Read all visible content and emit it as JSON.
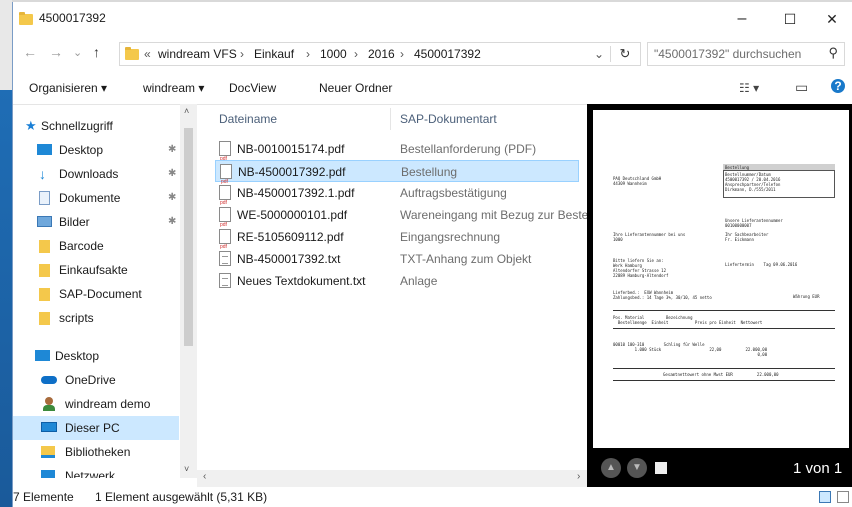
{
  "window": {
    "title": "4500017392",
    "min": "–",
    "max": "☐",
    "close": "✕"
  },
  "address": {
    "back": "←",
    "forward": "→",
    "dropdown": "⌄",
    "up": "↑",
    "chevron": "«",
    "crumbs": [
      "windream VFS",
      "Einkauf",
      "1000",
      "2016",
      "4500017392"
    ],
    "sep": "›",
    "refresh": "↻",
    "search_placeholder": "\"4500017392\" durchsuchen",
    "search_icon": "⚲"
  },
  "toolbar": {
    "organize": "Organisieren ▾",
    "windream": "windream ▾",
    "docview": "DocView",
    "new_folder": "Neuer Ordner",
    "view_icon": "☷ ▾",
    "pane_icon": "▭",
    "help_icon": "?"
  },
  "navigation": {
    "items": [
      {
        "label": "Schnellzugriff",
        "icon": "star-icon",
        "pinned": false
      },
      {
        "label": "Desktop",
        "icon": "desktop-icon",
        "pinned": true
      },
      {
        "label": "Downloads",
        "icon": "download-icon",
        "pinned": true
      },
      {
        "label": "Dokumente",
        "icon": "documents-icon",
        "pinned": true
      },
      {
        "label": "Bilder",
        "icon": "pictures-icon",
        "pinned": true
      },
      {
        "label": "Barcode",
        "icon": "folder-icon",
        "pinned": false
      },
      {
        "label": "Einkaufsakte",
        "icon": "folder-icon",
        "pinned": false
      },
      {
        "label": "SAP-Document",
        "icon": "folder-icon",
        "pinned": false
      },
      {
        "label": "scripts",
        "icon": "folder-icon",
        "pinned": false
      },
      {
        "label": "Desktop",
        "icon": "desktop-icon",
        "pinned": false
      },
      {
        "label": "OneDrive",
        "icon": "cloud-icon",
        "pinned": false
      },
      {
        "label": "windream demo",
        "icon": "user-icon",
        "pinned": false
      },
      {
        "label": "Dieser PC",
        "icon": "computer-icon",
        "pinned": false
      },
      {
        "label": "Bibliotheken",
        "icon": "library-icon",
        "pinned": false
      },
      {
        "label": "Netzwerk",
        "icon": "network-icon",
        "pinned": false
      }
    ],
    "pin_glyph": "📌"
  },
  "files": {
    "col_name": "Dateiname",
    "col_type": "SAP-Dokumentart",
    "rows": [
      {
        "name": "NB-0010015174.pdf",
        "type": "Bestellanforderung (PDF)",
        "kind": "pdf"
      },
      {
        "name": "NB-4500017392.pdf",
        "type": "Bestellung",
        "kind": "pdf"
      },
      {
        "name": "NB-4500017392.1.pdf",
        "type": "Auftragsbestätigung",
        "kind": "pdf"
      },
      {
        "name": "WE-5000000101.pdf",
        "type": "Wareneingang mit Bezug zur Bestell",
        "kind": "pdf"
      },
      {
        "name": "RE-5105609112.pdf",
        "type": "Eingangsrechnung",
        "kind": "pdf"
      },
      {
        "name": "NB-4500017392.txt",
        "type": "TXT-Anhang zum Objekt",
        "kind": "txt"
      },
      {
        "name": "Neues Textdokument.txt",
        "type": "Anlage",
        "kind": "txt"
      }
    ]
  },
  "preview": {
    "page_label": "1 von 1",
    "doc": {
      "header_title": "Bestellung",
      "sender": "PAQ Deutschland GmbH\n44309 Wannheim",
      "box_lines": "Bestellnummer/Datum\n4500017392 / 20.04.2016\nAnsprechpartner/Telefon\nDirkmann, D./555/2011",
      "supplier_no": "Unsere Lieferantennummer\n00100000007",
      "left_block": "Ihre Lieferantennummer bei uns\n1000",
      "right_block": "Ihr Sachbearbeiter\nFr. Eickmann",
      "address_block": "Bitte liefern Sie an:\nWerk Hamburg\nAltendorfer Strasse 12\n22089 Hamburg-Altendorf",
      "delivery_date": "Liefertermin    Tag 09.06.2016",
      "terms": "Lieferbed.:  EXW Wannheim\nZahlungsbed.: 14 Tage 3%, 30/10, 45 netto",
      "currency": "Währung EUR",
      "table_head": "Pos. Material         Bezeichnung\n  Bestellmenge  Einheit           Preis pro Einheit  Nettowert",
      "table_row": "00010 100-310        Schling für Welle\n         1.000 Stück                    22,00          22.000,00\n                                                            0,00",
      "total": "Gesamtnettowert ohne Mwst EUR          22.000,00"
    }
  },
  "status": {
    "count": "7 Elemente",
    "selection": "1 Element ausgewählt (5,31 KB)"
  }
}
